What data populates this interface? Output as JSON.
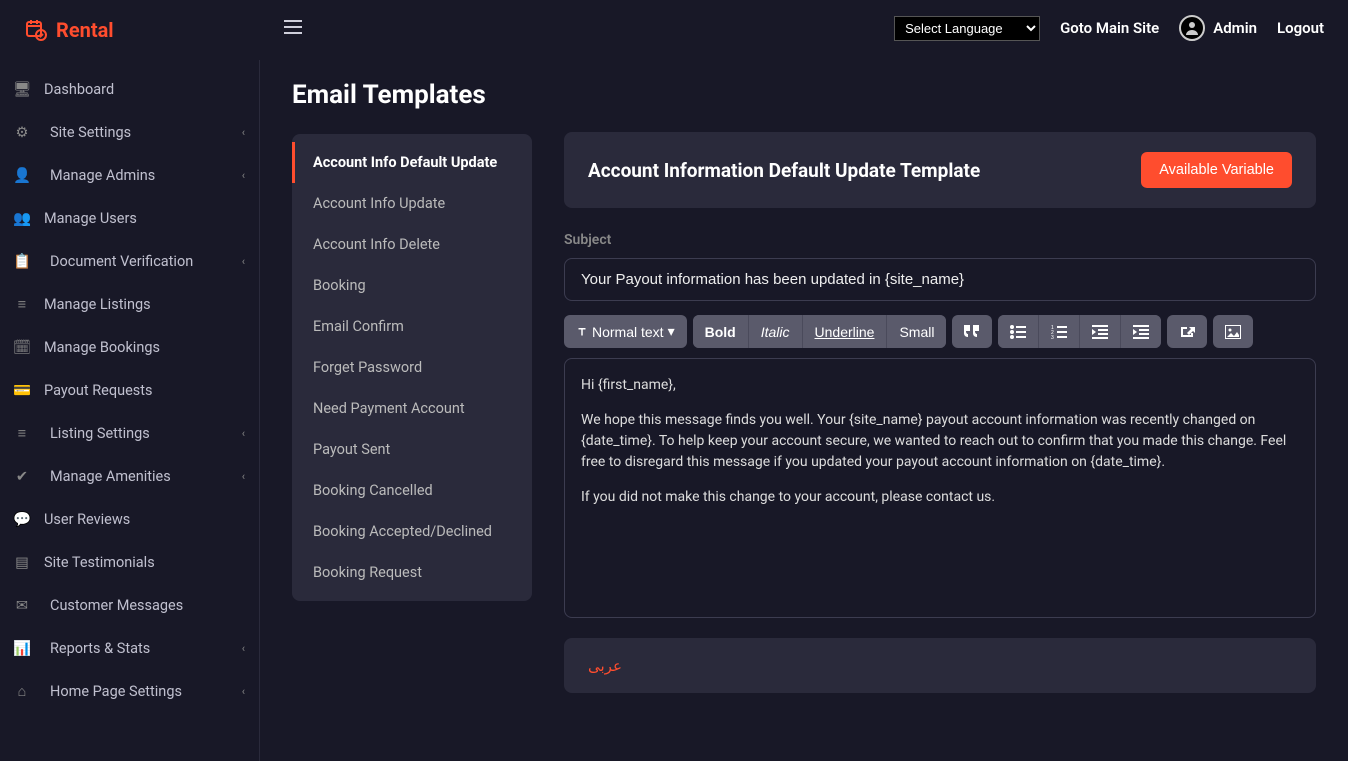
{
  "brand": {
    "name": "Rental"
  },
  "topbar": {
    "language_placeholder": "Select Language",
    "main_site": "Goto Main Site",
    "user_name": "Admin",
    "logout": "Logout"
  },
  "sidebar": {
    "items": [
      {
        "icon": "monitor",
        "label": "Dashboard",
        "expandable": false,
        "indent": false
      },
      {
        "icon": "gear",
        "label": "Site Settings",
        "expandable": true,
        "indent": true
      },
      {
        "icon": "admin",
        "label": "Manage Admins",
        "expandable": true,
        "indent": true
      },
      {
        "icon": "users",
        "label": "Manage Users",
        "expandable": false,
        "indent": false
      },
      {
        "icon": "doc",
        "label": "Document Verification",
        "expandable": true,
        "indent": true
      },
      {
        "icon": "list",
        "label": "Manage Listings",
        "expandable": false,
        "indent": false
      },
      {
        "icon": "calendar",
        "label": "Manage Bookings",
        "expandable": false,
        "indent": false
      },
      {
        "icon": "card",
        "label": "Payout Requests",
        "expandable": false,
        "indent": false
      },
      {
        "icon": "sliders",
        "label": "Listing Settings",
        "expandable": true,
        "indent": true
      },
      {
        "icon": "check",
        "label": "Manage Amenities",
        "expandable": true,
        "indent": true
      },
      {
        "icon": "chat",
        "label": "User Reviews",
        "expandable": false,
        "indent": false
      },
      {
        "icon": "quote",
        "label": "Site Testimonials",
        "expandable": false,
        "indent": false
      },
      {
        "icon": "msg",
        "label": "Customer Messages",
        "expandable": false,
        "indent": true
      },
      {
        "icon": "chart",
        "label": "Reports & Stats",
        "expandable": true,
        "indent": true
      },
      {
        "icon": "home",
        "label": "Home Page Settings",
        "expandable": true,
        "indent": true
      }
    ]
  },
  "page": {
    "title": "Email Templates"
  },
  "templates": [
    {
      "label": "Account Info Default Update",
      "active": true
    },
    {
      "label": "Account Info Update",
      "active": false
    },
    {
      "label": "Account Info Delete",
      "active": false
    },
    {
      "label": "Booking",
      "active": false
    },
    {
      "label": "Email Confirm",
      "active": false
    },
    {
      "label": "Forget Password",
      "active": false
    },
    {
      "label": "Need Payment Account",
      "active": false
    },
    {
      "label": "Payout Sent",
      "active": false
    },
    {
      "label": "Booking Cancelled",
      "active": false
    },
    {
      "label": "Booking Accepted/Declined",
      "active": false
    },
    {
      "label": "Booking Request",
      "active": false
    }
  ],
  "editor": {
    "header_title": "Account Information Default Update Template",
    "available_variable_btn": "Available Variable",
    "subject_label": "Subject",
    "subject_value": "Your Payout information has been updated in {site_name}",
    "toolbar": {
      "format": "Normal text",
      "bold": "Bold",
      "italic": "Italic",
      "underline": "Underline",
      "small": "Small"
    },
    "body_p1": "Hi {first_name},",
    "body_p2": "We hope this message finds you well. Your {site_name} payout account information was recently changed on {date_time}. To help keep your account secure, we wanted to reach out to confirm that you made this change. Feel free to disregard this message if you updated your payout account information on {date_time}.",
    "body_p3": "If you did not make this change to your account, please contact us."
  },
  "extra_lang": {
    "label": "عربى"
  },
  "icons": {
    "monitor": "🖥",
    "gear": "⚙",
    "admin": "👤",
    "users": "👥",
    "doc": "📋",
    "list": "≡",
    "calendar": "🗓",
    "card": "💳",
    "sliders": "≡",
    "check": "✔",
    "chat": "💬",
    "quote": "▤",
    "msg": "✉",
    "chart": "📊",
    "home": "⌂"
  }
}
